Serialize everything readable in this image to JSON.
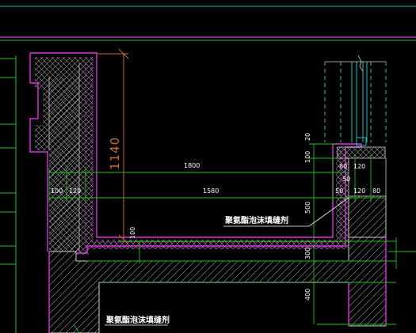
{
  "drawing": {
    "dimensions": {
      "d1800": "1800",
      "d1580": "1580",
      "d1140": "1140",
      "d100_left": "100",
      "d120_left": "120",
      "d100_inner": "100",
      "d20": "20",
      "d100_right": "100",
      "d80_a": "80",
      "d120_a": "120",
      "d50_a": "50",
      "d50_b": "50",
      "d120_b": "120",
      "d80_b": "80",
      "d500": "500",
      "d300": "300",
      "d400": "400"
    },
    "notes": {
      "coating_upper": "聚氨酯泡沫填缝剂",
      "coating_lower": "聚氨酯泡沫填缝剂"
    }
  }
}
